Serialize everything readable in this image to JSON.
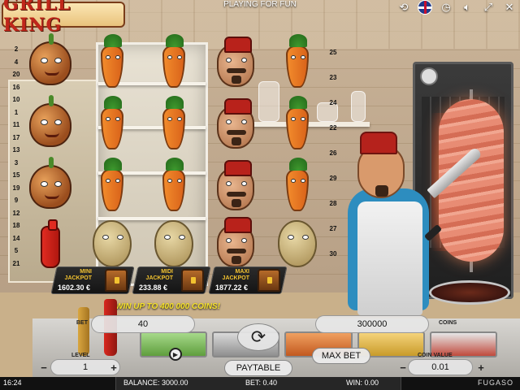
{
  "header": {
    "logo_text": "GRILL KING",
    "mode_label": "PLAYING FOR FUN",
    "icons": [
      "history-icon",
      "language-flag-icon",
      "timer-icon",
      "sound-icon",
      "fullscreen-icon",
      "close-icon"
    ]
  },
  "paylines": {
    "left": [
      "2",
      "4",
      "20",
      "16",
      "10",
      "1",
      "11",
      "17",
      "13",
      "3",
      "15",
      "19",
      "9",
      "12",
      "18",
      "14",
      "5",
      "21"
    ],
    "right": [
      "25",
      "23",
      "24",
      "22",
      "26",
      "29",
      "28",
      "27",
      "30"
    ]
  },
  "reels": [
    [
      "onion",
      "onion",
      "onion",
      "ketchup"
    ],
    [
      "carrot",
      "carrot",
      "carrot",
      "potato"
    ],
    [
      "carrot",
      "carrot",
      "carrot",
      "potato"
    ],
    [
      "chef",
      "chef",
      "chef",
      "chef"
    ],
    [
      "carrot",
      "carrot",
      "carrot",
      "potato"
    ]
  ],
  "jackpots": [
    {
      "label_line1": "MINI",
      "label_line2": "JACKPOT",
      "value": "1602.30 €"
    },
    {
      "label_line1": "MIDI",
      "label_line2": "JACKPOT",
      "value": "233.88 €"
    },
    {
      "label_line1": "MAXI",
      "label_line2": "JACKPOT",
      "value": "1877.22 €"
    }
  ],
  "win_banner": "WIN UP TO 400 000 COINS!",
  "controls": {
    "bet_label": "BET",
    "bet_value": "40",
    "coins_label": "COINS",
    "coins_value": "300000",
    "level_label": "LEVEL",
    "level_value": "1",
    "coin_value_label": "COIN VALUE",
    "coin_value": "0.01",
    "minus": "−",
    "plus": "+",
    "max_bet": "MAX BET",
    "paytable": "PAYTABLE",
    "spin_symbol": "⟳",
    "autoplay_symbol": "▶"
  },
  "status": {
    "time": "16:24",
    "balance": "BALANCE: 3000.00",
    "bet": "BET: 0.40",
    "win": "WIN: 0.00",
    "brand": "FUGASO"
  }
}
